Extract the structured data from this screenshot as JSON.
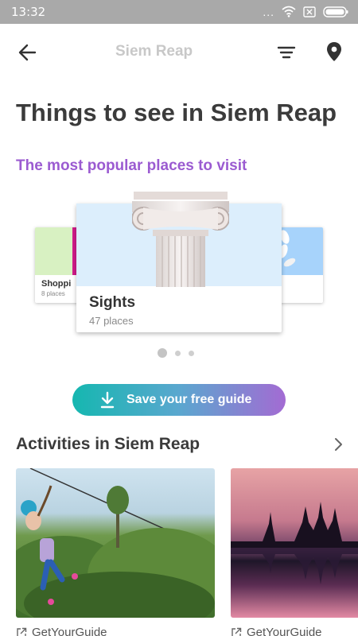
{
  "status_bar": {
    "time": "13:32",
    "dots": "..."
  },
  "app_bar": {
    "title": "Siem Reap"
  },
  "heading": {
    "title": "Things to see in Siem Reap",
    "subtitle": "The most popular places to visit"
  },
  "carousel": {
    "cards": [
      {
        "name": "Shoppi",
        "count": "8 places"
      },
      {
        "name": "Sights",
        "count": "47 places"
      }
    ],
    "active_index": 1,
    "dots": 3
  },
  "save_button": {
    "label": "Save your free guide"
  },
  "activities": {
    "title": "Activities in Siem Reap",
    "items": [
      {
        "provider": "GetYourGuide"
      },
      {
        "provider": "GetYourGuide"
      }
    ]
  },
  "colors": {
    "accent_purple": "#9b5bd1",
    "button_gradient_start": "#15b7b0",
    "button_gradient_end": "#a36bd3"
  }
}
